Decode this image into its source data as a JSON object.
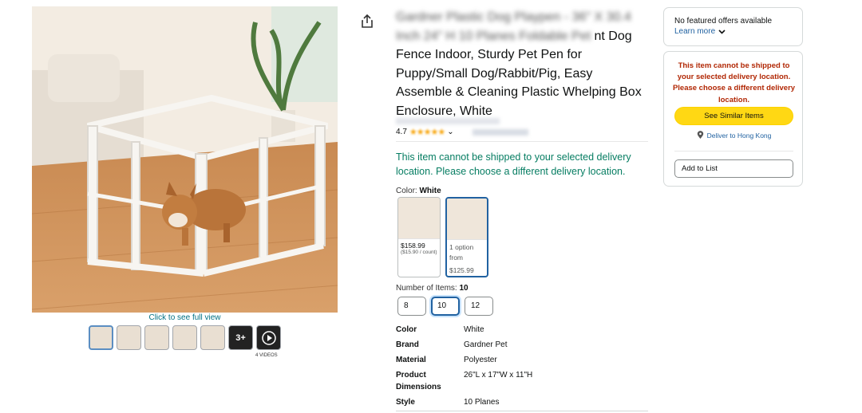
{
  "gallery": {
    "full_view_link": "Click to see full view",
    "thumb_more_label": "3+",
    "videos_caption": "4 VIDEOS"
  },
  "product": {
    "title_blurred_1": "Gardner Plastic Dog Playpen - 36\" X 30.4",
    "title_blurred_2": "Inch 24\" H 10 Planes Foldable Pet",
    "title_visible_1": "nt Dog",
    "title_visible_2": "Fence Indoor, Sturdy Pet Pen for Puppy/Small Dog/Rabbit/Pig, Easy Assemble & Cleaning Plastic Whelping Box Enclosure, White",
    "rating": "4.7",
    "rating_stars": "★★★★★",
    "rating_dropdown": "⌄",
    "shipping_message": "This item cannot be shipped to your selected delivery location. Please choose a different delivery location."
  },
  "color": {
    "label": "Color:",
    "selected": "White",
    "swatches": [
      {
        "price": "$158.99",
        "unit_price": "($15.90 / count)"
      },
      {
        "option_text": "1 option from",
        "price": "$125.99"
      }
    ]
  },
  "number_of_items": {
    "label": "Number of Items:",
    "selected": "10",
    "options": [
      "8",
      "10",
      "12"
    ]
  },
  "specs": [
    {
      "key": "Color",
      "value": "White"
    },
    {
      "key": "Brand",
      "value": "Gardner Pet"
    },
    {
      "key": "Material",
      "value": "Polyester"
    },
    {
      "key": "Product Dimensions",
      "value": "26\"L x 17\"W x 11\"H"
    },
    {
      "key": "Style",
      "value": "10 Planes"
    }
  ],
  "buybox": {
    "no_offers": "No featured offers available",
    "learn_more": "Learn more",
    "warning": "This item cannot be shipped to your selected delivery location. Please choose a different delivery location.",
    "see_similar": "See Similar Items",
    "deliver_to": "Deliver to Hong Kong",
    "add_to_list": "Add to List"
  },
  "colors": {
    "link": "#007185",
    "success_green": "#067d62",
    "warning_red": "#b12704",
    "button_yellow": "#ffd814",
    "selected_border": "#2162a1"
  }
}
